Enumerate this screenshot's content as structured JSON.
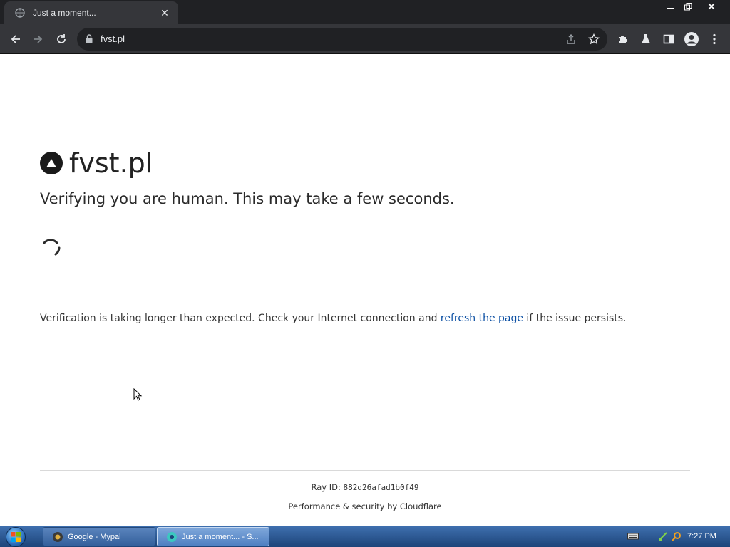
{
  "browser": {
    "tab_title": "Just a moment...",
    "url": "fvst.pl",
    "window_controls": {
      "minimize": "—",
      "restore": "❐",
      "close": "✕"
    }
  },
  "page": {
    "site_name": "fvst.pl",
    "verify_text": "Verifying you are human. This may take a few seconds.",
    "longer_prefix": "Verification is taking longer than expected. Check your Internet connection and ",
    "refresh_link": "refresh the page",
    "longer_suffix": " if the issue persists.",
    "ray_label": "Ray ID: ",
    "ray_id": "882d26afad1b0f49",
    "perf_text": "Performance & security by Cloudflare"
  },
  "taskbar": {
    "tasks": [
      {
        "label": "Google - Mypal"
      },
      {
        "label": "Just a moment... - S..."
      }
    ],
    "clock": "7:27 PM"
  },
  "colors": {
    "link": "#0b4fa3",
    "chrome_dark": "#202124",
    "chrome_toolbar": "#35363a"
  }
}
